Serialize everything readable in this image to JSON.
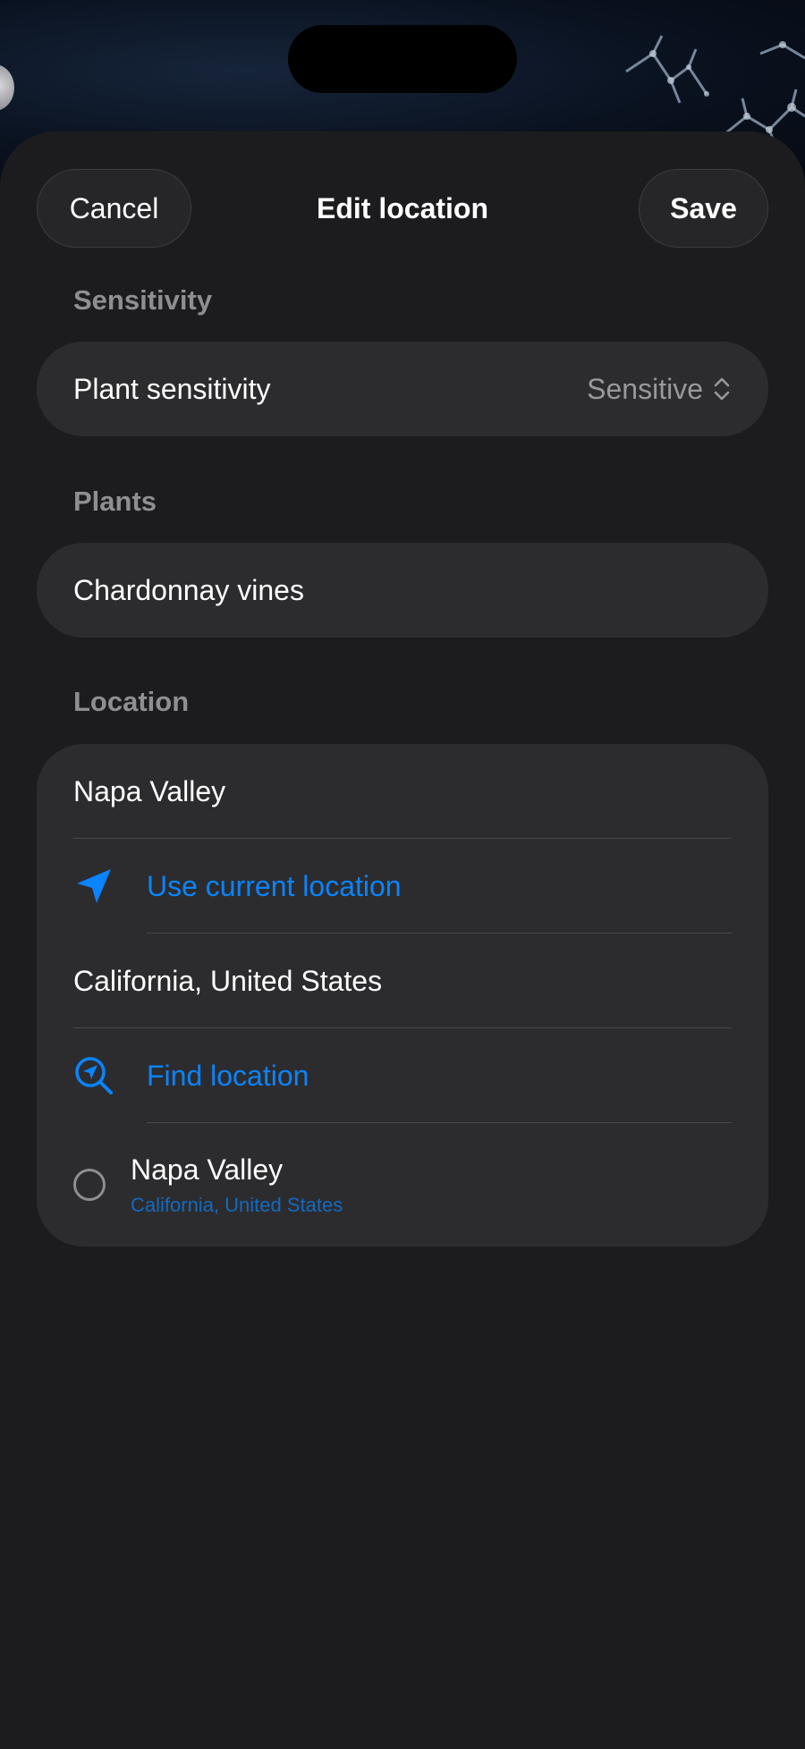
{
  "nav": {
    "cancel_label": "Cancel",
    "title": "Edit location",
    "save_label": "Save"
  },
  "sensitivity": {
    "header": "Sensitivity",
    "row_label": "Plant sensitivity",
    "selected_value": "Sensitive",
    "icon": "chevron-up-down-icon"
  },
  "plants": {
    "header": "Plants",
    "value": "Chardonnay vines"
  },
  "location": {
    "header": "Location",
    "name_value": "Napa Valley",
    "use_current_label": "Use current location",
    "use_current_icon": "location-arrow-icon",
    "region_value": "California, United States",
    "find_label": "Find location",
    "find_icon": "search-location-icon",
    "results": [
      {
        "title": "Napa Valley",
        "subtitle": "California, United States",
        "selected": false
      }
    ]
  },
  "colors": {
    "accent": "#0a84ff",
    "sheet_background": "#1c1c1e",
    "group_background": "#2c2c2e",
    "secondary_text": "#8e8e93"
  }
}
